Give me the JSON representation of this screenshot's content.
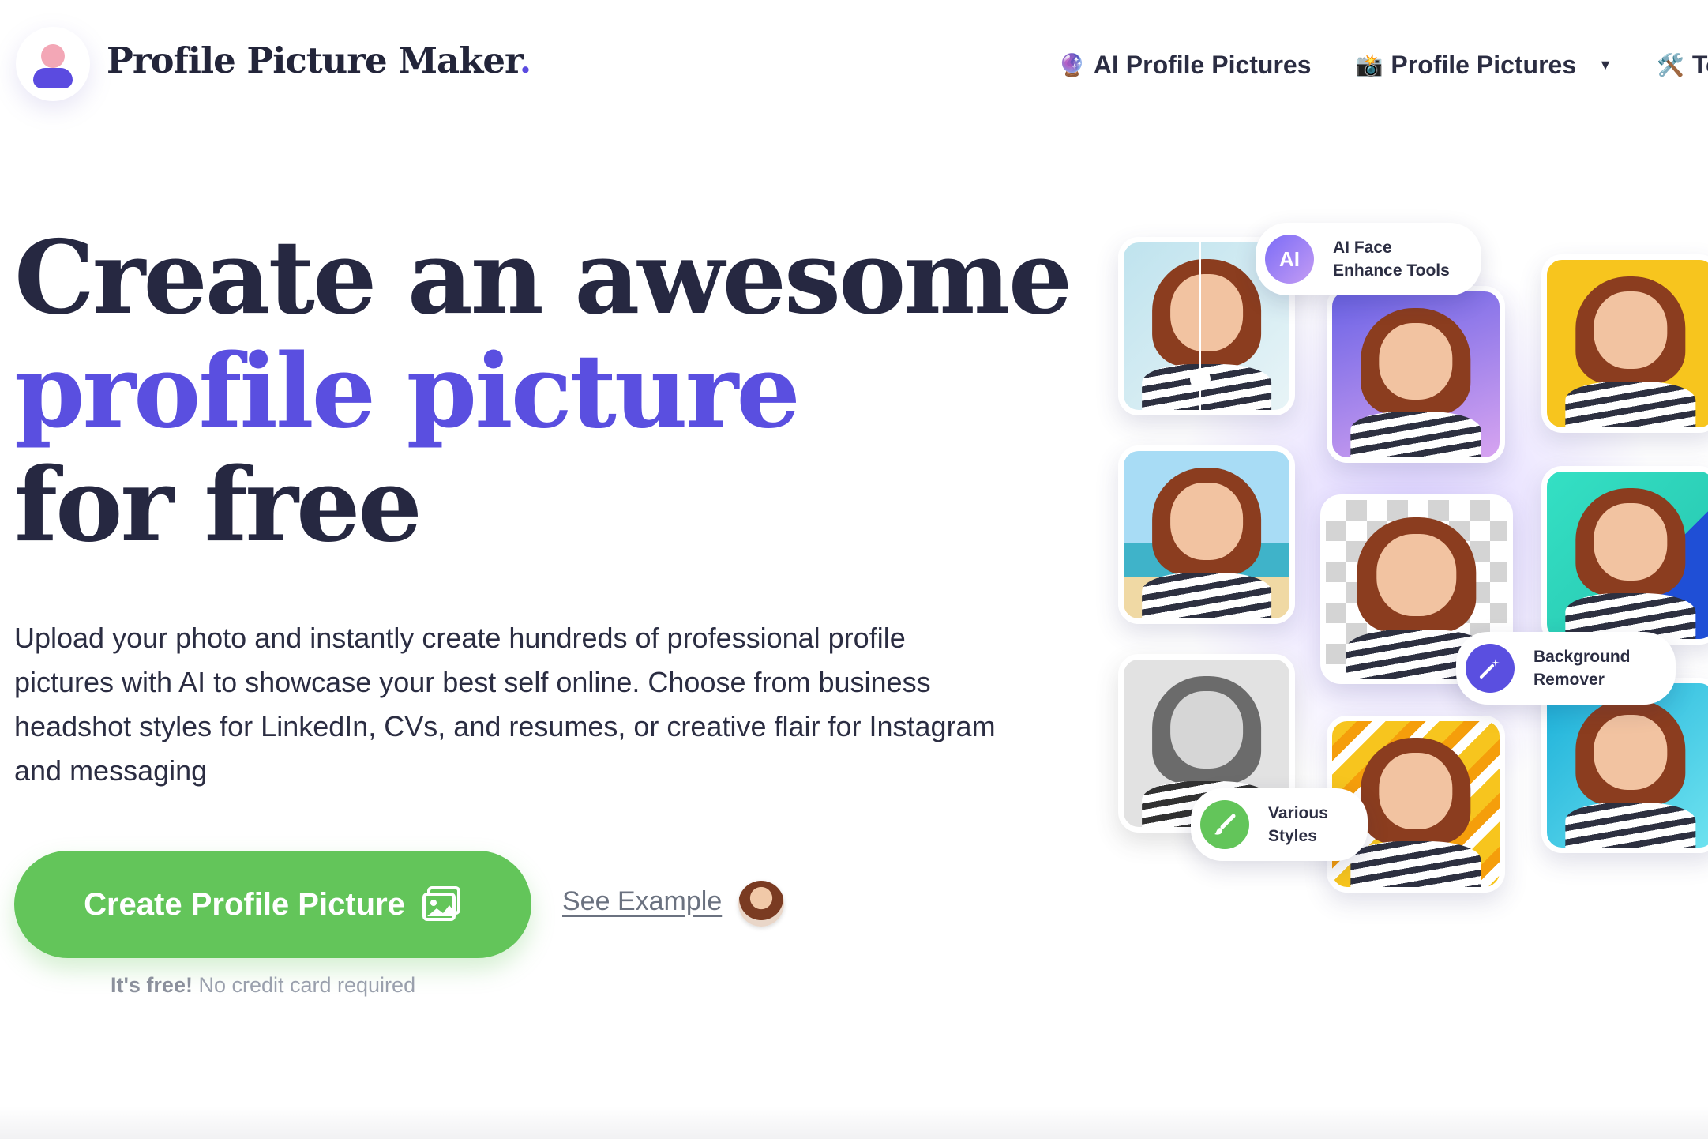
{
  "header": {
    "brand": "Profile Picture Maker",
    "brand_dot": ".",
    "nav": [
      {
        "emoji": "🔮",
        "label": "AI Profile Pictures"
      },
      {
        "emoji": "📸",
        "label": "Profile Pictures",
        "caret": "▼"
      },
      {
        "emoji": "🛠️",
        "label": "Tools"
      }
    ]
  },
  "hero": {
    "line1": "Create an awesome",
    "line2": "profile picture",
    "line3": "for free",
    "description": "Upload your photo and instantly create hundreds of professional profile pictures with AI to showcase your best self online. Choose from business headshot styles for LinkedIn, CVs, and resumes, or creative flair for Instagram and messaging",
    "cta_label": "Create Profile Picture",
    "see_example": "See Example",
    "free_bold": "It's free!",
    "free_rest": " No credit card required"
  },
  "badges": {
    "ai_icon": "AI",
    "ai_line1": "AI Face",
    "ai_line2": "Enhance Tools",
    "bg_line1": "Background",
    "bg_line2": "Remover",
    "styles_line1": "Various",
    "styles_line2": "Styles"
  },
  "colors": {
    "accent": "#5a4fe0",
    "cta_green": "#63c55a",
    "heading": "#262841"
  },
  "icons": [
    "user-logo-icon",
    "crystal-ball-icon",
    "camera-icon",
    "tools-icon",
    "caret-down-icon",
    "image-icon",
    "magic-wand-icon",
    "brush-icon"
  ]
}
